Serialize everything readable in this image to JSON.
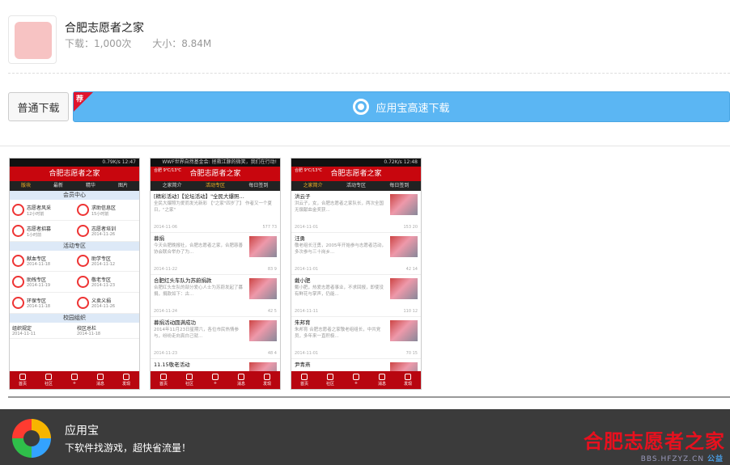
{
  "app": {
    "name": "合肥志愿者之家",
    "downloads": "下载：1,000次",
    "size": "大小：8.84M"
  },
  "buttons": {
    "normal_download": "普通下载",
    "fast_download": "应用宝高速下载",
    "recommend_tag": "荐"
  },
  "screenshots": [
    {
      "status_right": "0.79K/s 12:47",
      "title": "合肥志愿者之家",
      "tabs": [
        "版块",
        "最新",
        "精华",
        "图片"
      ],
      "active_tab": "版块",
      "sections": [
        {
          "header": "会员中心",
          "cells": [
            {
              "title": "志愿者风采",
              "meta": "12小时前"
            },
            {
              "title": "求助信息区",
              "meta": "15小时前"
            },
            {
              "title": "志愿者招募",
              "meta": "1小时前"
            },
            {
              "title": "志愿者培训",
              "meta": "2014-11-26"
            }
          ]
        },
        {
          "header": "活动专区",
          "cells": [
            {
              "title": "献血专区",
              "meta": "2014-11-18"
            },
            {
              "title": "助学专区",
              "meta": "2014-11-12"
            },
            {
              "title": "助残专区",
              "meta": "2014-11-19"
            },
            {
              "title": "敬老专区",
              "meta": "2014-11-23"
            },
            {
              "title": "环保专区",
              "meta": "2014-11-18"
            },
            {
              "title": "义卖义捐",
              "meta": "2014-11-26"
            }
          ]
        },
        {
          "header": "校园组织",
          "cells": [
            {
              "title": "组织规定",
              "meta": "2014-11-11"
            },
            {
              "title": "校区总栏",
              "meta": "2014-11-18"
            }
          ]
        }
      ],
      "bottom": [
        "首页",
        "社区",
        "+",
        "消息",
        "发现"
      ]
    },
    {
      "status_right": "WWF世界自然基金会: 拯救江豚的微笑，我们在行动!",
      "title": "合肥志愿者之家",
      "badge": "合肥 9℃/13℃",
      "tabs": [
        "之家简介",
        "活动专区",
        "每日签到"
      ],
      "active_tab": "活动专区",
      "news": [
        {
          "title": "[精彩活动]【论坛活动】\"全民大爆照...",
          "desc": "全民大爆照为爱而发光新彩 【\"之家\"四岁了】 作者又一个夏日，\"之家\"",
          "date": "2014-11-06",
          "stats": "577 73",
          "thumb": false
        },
        {
          "title": "募捐",
          "desc": "今天合肥晚报社，合肥志愿者之家，合肥慈善协会联合举办了为...",
          "date": "2014-11-22",
          "stats": "83 9",
          "thumb": true
        },
        {
          "title": "合肥红头车队为苏蔚捐款",
          "desc": "合肥红头车队的部分爱心人士为苏蔚发起了募捐，捐款如下：古...",
          "date": "2014-11-24",
          "stats": "42 5",
          "thumb": true
        },
        {
          "title": "募捐活动圆满成功",
          "desc": "2014年11月23日星期六，各位市民热情参与，纷纷走向真白己就...",
          "date": "2014-11-23",
          "stats": "48 4",
          "thumb": true
        },
        {
          "title": "11.15敬老活动",
          "desc": "",
          "date": "",
          "stats": "",
          "thumb": true
        }
      ],
      "bottom": [
        "首页",
        "社区",
        "+",
        "消息",
        "发现"
      ]
    },
    {
      "status_right": "0.72K/s 12:48",
      "title": "合肥志愿者之家",
      "badge": "合肥 9℃/13℃",
      "tabs": [
        "之家简介",
        "活动专区",
        "每日签到"
      ],
      "active_tab": "之家简介",
      "news": [
        {
          "title": "洪云子",
          "desc": "洪云子，女，合肥志愿者之家队长，两次全国无偿献血金奖获...",
          "date": "2014-11-01",
          "stats": "153 20",
          "thumb": true
        },
        {
          "title": "汪勇",
          "desc": "敬老组长汪勇，2005年开始参与志愿者活动，多次参与三十岗乡...",
          "date": "2014-11-01",
          "stats": "42 14",
          "thumb": true
        },
        {
          "title": "戴小肥",
          "desc": "戴小肥，热爱志愿者事业，不求回报，即使没有鲜花与掌声，仍能...",
          "date": "2014-11-11",
          "stats": "110 12",
          "thumb": true
        },
        {
          "title": "朱邦育",
          "desc": "朱邦育 合肥志愿者之家敬老组组长，中共党员，多年来一直积极...",
          "date": "2014-11-01",
          "stats": "70 15",
          "thumb": true
        },
        {
          "title": "尹青燕",
          "desc": "",
          "date": "",
          "stats": "",
          "thumb": true
        }
      ],
      "bottom": [
        "首页",
        "社区",
        "+",
        "消息",
        "发现"
      ]
    }
  ],
  "footer": {
    "name": "应用宝",
    "slogan": "下软件找游戏，超快省流量！",
    "watermark": "合肥志愿者之家",
    "watermark_url_a": "BBS.HFZYZ.CN",
    "watermark_url_b": "公益"
  }
}
